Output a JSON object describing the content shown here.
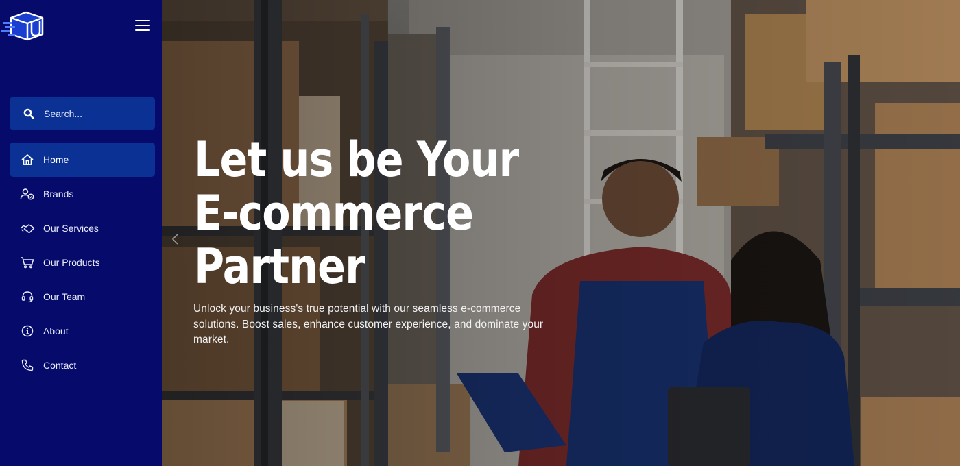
{
  "sidebar": {
    "logo_icon": "cube-delivery-logo",
    "menu_icon": "hamburger-icon",
    "search": {
      "placeholder": "Search...",
      "icon": "search-icon"
    },
    "nav_items": [
      {
        "label": "Home",
        "icon": "home-icon",
        "active": true
      },
      {
        "label": "Brands",
        "icon": "users-icon",
        "active": false
      },
      {
        "label": "Our Services",
        "icon": "handshake-icon",
        "active": false
      },
      {
        "label": "Our Products",
        "icon": "cart-icon",
        "active": false
      },
      {
        "label": "Our Team",
        "icon": "headset-icon",
        "active": false
      },
      {
        "label": "About",
        "icon": "info-icon",
        "active": false
      },
      {
        "label": "Contact",
        "icon": "phone-icon",
        "active": false
      }
    ]
  },
  "hero": {
    "headline": [
      "Let us be Your",
      "E-commerce",
      "Partner"
    ],
    "subtext": "Unlock your business's true potential with our seamless e-commerce solutions. Boost sales, enhance customer experience, and dominate your market.",
    "prev_icon": "chevron-left-icon"
  },
  "colors": {
    "sidebar_bg": "#050a6b",
    "active_bg": "#0a3193",
    "text": "#ffffff"
  }
}
